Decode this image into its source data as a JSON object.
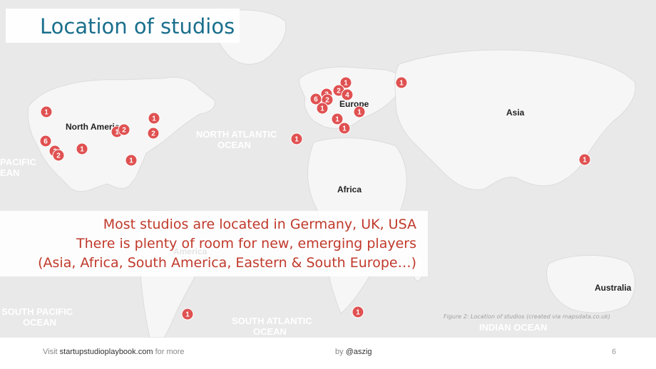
{
  "title": "Location of studios",
  "map": {
    "labels": [
      {
        "id": "north-america",
        "text": "North America",
        "kind": "continent"
      },
      {
        "id": "europe",
        "text": "Europe",
        "kind": "continent"
      },
      {
        "id": "asia",
        "text": "Asia",
        "kind": "continent"
      },
      {
        "id": "africa",
        "text": "Africa",
        "kind": "continent"
      },
      {
        "id": "australia",
        "text": "Australia",
        "kind": "continent"
      },
      {
        "id": "south-america",
        "text": "America",
        "kind": "continent"
      },
      {
        "id": "north-atlantic",
        "text": "NORTH ATLANTIC\nOCEAN",
        "kind": "ocean"
      },
      {
        "id": "pacific",
        "text": "PACIFIC\nEAN",
        "kind": "ocean"
      },
      {
        "id": "south-pacific",
        "text": "SOUTH PACIFIC\nOCEAN",
        "kind": "ocean"
      },
      {
        "id": "south-atlantic",
        "text": "SOUTH ATLANTIC\nOCEAN",
        "kind": "ocean"
      },
      {
        "id": "indian",
        "text": "INDIAN OCEAN",
        "kind": "ocean"
      }
    ],
    "markers": [
      {
        "id": "na-nw",
        "count": "1"
      },
      {
        "id": "na-sf",
        "count": "6"
      },
      {
        "id": "na-la1",
        "count": "2"
      },
      {
        "id": "na-la2",
        "count": "2"
      },
      {
        "id": "na-sw",
        "count": "1"
      },
      {
        "id": "na-chi1",
        "count": "1"
      },
      {
        "id": "na-chi2",
        "count": "2"
      },
      {
        "id": "na-ne1",
        "count": "1"
      },
      {
        "id": "na-ne2",
        "count": "2"
      },
      {
        "id": "na-fl",
        "count": "1"
      },
      {
        "id": "atl",
        "count": "1"
      },
      {
        "id": "eu-uk",
        "count": "6"
      },
      {
        "id": "eu-1",
        "count": "2"
      },
      {
        "id": "eu-2",
        "count": "2"
      },
      {
        "id": "eu-3",
        "count": "1"
      },
      {
        "id": "eu-4",
        "count": "1"
      },
      {
        "id": "eu-5",
        "count": "2"
      },
      {
        "id": "eu-6",
        "count": "4"
      },
      {
        "id": "eu-7",
        "count": "1"
      },
      {
        "id": "eu-8",
        "count": "1"
      },
      {
        "id": "eu-9",
        "count": "1"
      },
      {
        "id": "eu-ru",
        "count": "1"
      },
      {
        "id": "asia-cn",
        "count": "1"
      },
      {
        "id": "sa-br",
        "count": "1"
      },
      {
        "id": "af-za",
        "count": "1"
      }
    ]
  },
  "callout": {
    "line1": "Most studios are located in Germany, UK, USA",
    "line2": "There is plenty of room for new, emerging players",
    "line3": "(Asia, Africa, South America, Eastern & South Europe…)"
  },
  "caption": "Figure 2: Location of studios (created via mapsdata.co.uk)",
  "footer": {
    "visit": "Visit",
    "link": "startupstudioplaybook.com",
    "more": "for more",
    "by": "by",
    "handle": "@aszig",
    "page": "6"
  },
  "colors": {
    "marker": "#e05151",
    "land": "#f5f5f5",
    "water": "#e9e9e9",
    "title": "#1a6f8c",
    "callout": "#c0392b"
  }
}
